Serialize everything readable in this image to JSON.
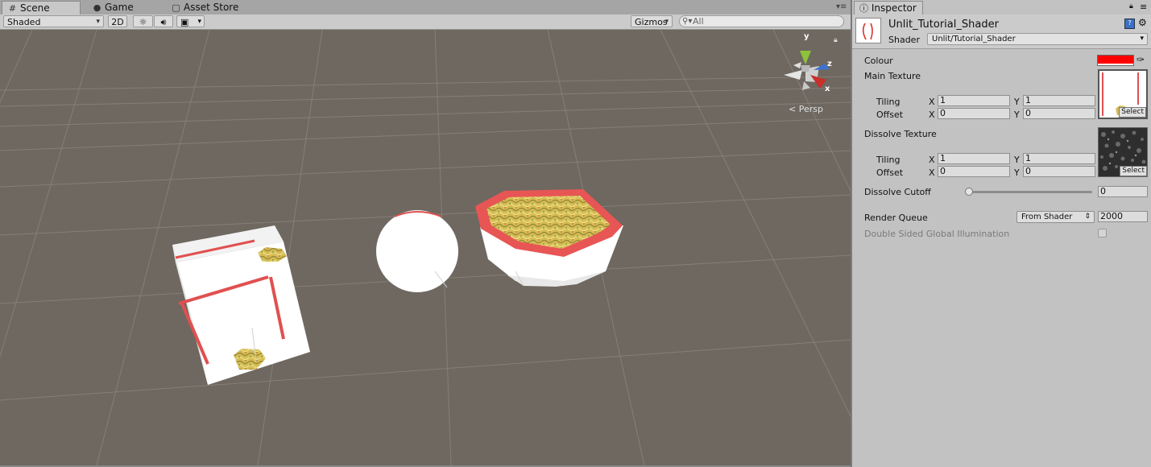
{
  "tabs": {
    "scene": "Scene",
    "game": "Game",
    "asset_store": "Asset Store"
  },
  "toolbar": {
    "draw_mode": "Shaded",
    "mode_2d": "2D",
    "gizmos": "Gizmos",
    "search_placeholder": "All"
  },
  "scene": {
    "projection": "Persp",
    "axis_x": "x",
    "axis_y": "y",
    "axis_z": "z"
  },
  "inspector": {
    "tab": "Inspector",
    "material_name": "Unlit_Tutorial_Shader",
    "shader_label": "Shader",
    "shader_value": "Unlit/Tutorial_Shader",
    "colour_label": "Colour",
    "colour_value": "#ff0000",
    "main_texture": {
      "label": "Main Texture",
      "tiling_label": "Tiling",
      "offset_label": "Offset",
      "tiling_x": "1",
      "tiling_y": "1",
      "offset_x": "0",
      "offset_y": "0",
      "select": "Select"
    },
    "dissolve_texture": {
      "label": "Dissolve Texture",
      "tiling_label": "Tiling",
      "offset_label": "Offset",
      "tiling_x": "1",
      "tiling_y": "1",
      "offset_x": "0",
      "offset_y": "0",
      "select": "Select"
    },
    "x_label": "X",
    "y_label": "Y",
    "dissolve_cutoff_label": "Dissolve Cutoff",
    "dissolve_cutoff_value": "0",
    "render_queue_label": "Render Queue",
    "render_queue_mode": "From Shader",
    "render_queue_value": "2000",
    "double_sided_label": "Double Sided Global Illumination"
  }
}
